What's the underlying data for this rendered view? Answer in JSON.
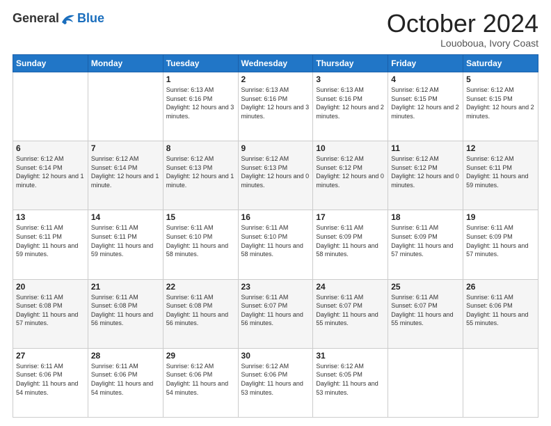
{
  "header": {
    "logo_general": "General",
    "logo_blue": "Blue",
    "month_title": "October 2024",
    "subtitle": "Louoboua, Ivory Coast"
  },
  "days_of_week": [
    "Sunday",
    "Monday",
    "Tuesday",
    "Wednesday",
    "Thursday",
    "Friday",
    "Saturday"
  ],
  "weeks": [
    [
      {
        "day": "",
        "sunrise": "",
        "sunset": "",
        "daylight": ""
      },
      {
        "day": "",
        "sunrise": "",
        "sunset": "",
        "daylight": ""
      },
      {
        "day": "1",
        "sunrise": "Sunrise: 6:13 AM",
        "sunset": "Sunset: 6:16 PM",
        "daylight": "Daylight: 12 hours and 3 minutes."
      },
      {
        "day": "2",
        "sunrise": "Sunrise: 6:13 AM",
        "sunset": "Sunset: 6:16 PM",
        "daylight": "Daylight: 12 hours and 3 minutes."
      },
      {
        "day": "3",
        "sunrise": "Sunrise: 6:13 AM",
        "sunset": "Sunset: 6:16 PM",
        "daylight": "Daylight: 12 hours and 2 minutes."
      },
      {
        "day": "4",
        "sunrise": "Sunrise: 6:12 AM",
        "sunset": "Sunset: 6:15 PM",
        "daylight": "Daylight: 12 hours and 2 minutes."
      },
      {
        "day": "5",
        "sunrise": "Sunrise: 6:12 AM",
        "sunset": "Sunset: 6:15 PM",
        "daylight": "Daylight: 12 hours and 2 minutes."
      }
    ],
    [
      {
        "day": "6",
        "sunrise": "Sunrise: 6:12 AM",
        "sunset": "Sunset: 6:14 PM",
        "daylight": "Daylight: 12 hours and 1 minute."
      },
      {
        "day": "7",
        "sunrise": "Sunrise: 6:12 AM",
        "sunset": "Sunset: 6:14 PM",
        "daylight": "Daylight: 12 hours and 1 minute."
      },
      {
        "day": "8",
        "sunrise": "Sunrise: 6:12 AM",
        "sunset": "Sunset: 6:13 PM",
        "daylight": "Daylight: 12 hours and 1 minute."
      },
      {
        "day": "9",
        "sunrise": "Sunrise: 6:12 AM",
        "sunset": "Sunset: 6:13 PM",
        "daylight": "Daylight: 12 hours and 0 minutes."
      },
      {
        "day": "10",
        "sunrise": "Sunrise: 6:12 AM",
        "sunset": "Sunset: 6:12 PM",
        "daylight": "Daylight: 12 hours and 0 minutes."
      },
      {
        "day": "11",
        "sunrise": "Sunrise: 6:12 AM",
        "sunset": "Sunset: 6:12 PM",
        "daylight": "Daylight: 12 hours and 0 minutes."
      },
      {
        "day": "12",
        "sunrise": "Sunrise: 6:12 AM",
        "sunset": "Sunset: 6:11 PM",
        "daylight": "Daylight: 11 hours and 59 minutes."
      }
    ],
    [
      {
        "day": "13",
        "sunrise": "Sunrise: 6:11 AM",
        "sunset": "Sunset: 6:11 PM",
        "daylight": "Daylight: 11 hours and 59 minutes."
      },
      {
        "day": "14",
        "sunrise": "Sunrise: 6:11 AM",
        "sunset": "Sunset: 6:11 PM",
        "daylight": "Daylight: 11 hours and 59 minutes."
      },
      {
        "day": "15",
        "sunrise": "Sunrise: 6:11 AM",
        "sunset": "Sunset: 6:10 PM",
        "daylight": "Daylight: 11 hours and 58 minutes."
      },
      {
        "day": "16",
        "sunrise": "Sunrise: 6:11 AM",
        "sunset": "Sunset: 6:10 PM",
        "daylight": "Daylight: 11 hours and 58 minutes."
      },
      {
        "day": "17",
        "sunrise": "Sunrise: 6:11 AM",
        "sunset": "Sunset: 6:09 PM",
        "daylight": "Daylight: 11 hours and 58 minutes."
      },
      {
        "day": "18",
        "sunrise": "Sunrise: 6:11 AM",
        "sunset": "Sunset: 6:09 PM",
        "daylight": "Daylight: 11 hours and 57 minutes."
      },
      {
        "day": "19",
        "sunrise": "Sunrise: 6:11 AM",
        "sunset": "Sunset: 6:09 PM",
        "daylight": "Daylight: 11 hours and 57 minutes."
      }
    ],
    [
      {
        "day": "20",
        "sunrise": "Sunrise: 6:11 AM",
        "sunset": "Sunset: 6:08 PM",
        "daylight": "Daylight: 11 hours and 57 minutes."
      },
      {
        "day": "21",
        "sunrise": "Sunrise: 6:11 AM",
        "sunset": "Sunset: 6:08 PM",
        "daylight": "Daylight: 11 hours and 56 minutes."
      },
      {
        "day": "22",
        "sunrise": "Sunrise: 6:11 AM",
        "sunset": "Sunset: 6:08 PM",
        "daylight": "Daylight: 11 hours and 56 minutes."
      },
      {
        "day": "23",
        "sunrise": "Sunrise: 6:11 AM",
        "sunset": "Sunset: 6:07 PM",
        "daylight": "Daylight: 11 hours and 56 minutes."
      },
      {
        "day": "24",
        "sunrise": "Sunrise: 6:11 AM",
        "sunset": "Sunset: 6:07 PM",
        "daylight": "Daylight: 11 hours and 55 minutes."
      },
      {
        "day": "25",
        "sunrise": "Sunrise: 6:11 AM",
        "sunset": "Sunset: 6:07 PM",
        "daylight": "Daylight: 11 hours and 55 minutes."
      },
      {
        "day": "26",
        "sunrise": "Sunrise: 6:11 AM",
        "sunset": "Sunset: 6:06 PM",
        "daylight": "Daylight: 11 hours and 55 minutes."
      }
    ],
    [
      {
        "day": "27",
        "sunrise": "Sunrise: 6:11 AM",
        "sunset": "Sunset: 6:06 PM",
        "daylight": "Daylight: 11 hours and 54 minutes."
      },
      {
        "day": "28",
        "sunrise": "Sunrise: 6:11 AM",
        "sunset": "Sunset: 6:06 PM",
        "daylight": "Daylight: 11 hours and 54 minutes."
      },
      {
        "day": "29",
        "sunrise": "Sunrise: 6:12 AM",
        "sunset": "Sunset: 6:06 PM",
        "daylight": "Daylight: 11 hours and 54 minutes."
      },
      {
        "day": "30",
        "sunrise": "Sunrise: 6:12 AM",
        "sunset": "Sunset: 6:06 PM",
        "daylight": "Daylight: 11 hours and 53 minutes."
      },
      {
        "day": "31",
        "sunrise": "Sunrise: 6:12 AM",
        "sunset": "Sunset: 6:05 PM",
        "daylight": "Daylight: 11 hours and 53 minutes."
      },
      {
        "day": "",
        "sunrise": "",
        "sunset": "",
        "daylight": ""
      },
      {
        "day": "",
        "sunrise": "",
        "sunset": "",
        "daylight": ""
      }
    ]
  ]
}
